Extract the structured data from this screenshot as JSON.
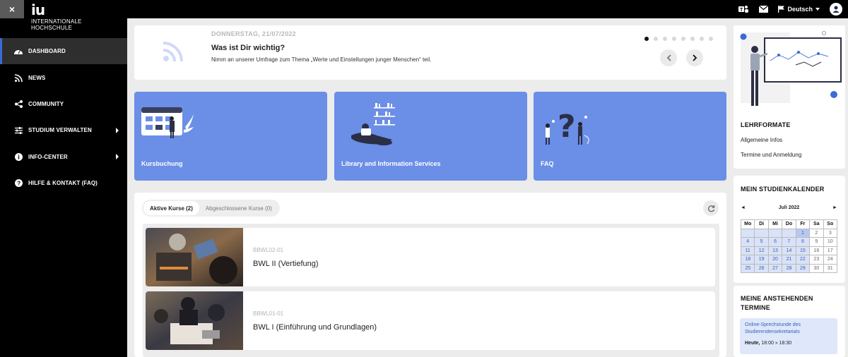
{
  "topbar": {
    "close_label": "×",
    "logo_mark": "iu",
    "logo_line1": "INTERNATIONALE",
    "logo_line2": "HOCHSCHULE",
    "teams_icon": "teams-icon",
    "mail_icon": "mail-icon",
    "language": "Deutsch",
    "profile_icon": "user-icon"
  },
  "sidebar": {
    "items": [
      {
        "label": "DASHBOARD",
        "icon": "dashboard-icon",
        "active": true
      },
      {
        "label": "NEWS",
        "icon": "rss-icon"
      },
      {
        "label": "COMMUNITY",
        "icon": "share-icon"
      },
      {
        "label": "STUDIUM VERWALTEN",
        "icon": "sliders-icon",
        "submenu": true
      },
      {
        "label": "INFO-CENTER",
        "icon": "info-icon",
        "submenu": true
      },
      {
        "label": "HILFE & KONTAKT (FAQ)",
        "icon": "help-icon"
      }
    ]
  },
  "announcement": {
    "date": "DONNERSTAG, 21/07/2022",
    "title": "Was ist Dir wichtig?",
    "text": "Nimm an unserer Umfrage zum Thema „Werte und Einstellungen junger Menschen“ teil.",
    "slide_count": 8,
    "active_slide": 1
  },
  "tiles": [
    {
      "label": "Kursbuchung"
    },
    {
      "label": "Library and Information Services"
    },
    {
      "label": "FAQ"
    }
  ],
  "courses": {
    "tabs": [
      "Aktive Kurse (2)",
      "Abgeschlossene Kurse (0)"
    ],
    "items": [
      {
        "code": "BBWL02-01",
        "name": "BWL II (Vertiefung)"
      },
      {
        "code": "BBWL01-01",
        "name": "BWL I (Einführung und Grundlagen)"
      }
    ]
  },
  "lehrformate": {
    "title": "LEHRFORMATE",
    "links": [
      "Allgemeine Infos",
      "Termine und Anmeldung"
    ]
  },
  "calendar": {
    "title": "MEIN STUDIENKALENDER",
    "prev": "◄",
    "next": "►",
    "month": "Juli 2022",
    "weekdays": [
      "Mo",
      "Di",
      "Mi",
      "Do",
      "Fr",
      "Sa",
      "So"
    ],
    "weeks": [
      [
        "",
        "",
        "",
        "",
        "1",
        "2",
        "3"
      ],
      [
        "4",
        "5",
        "6",
        "7",
        "8",
        "9",
        "10"
      ],
      [
        "11",
        "12",
        "13",
        "14",
        "15",
        "16",
        "17"
      ],
      [
        "18",
        "19",
        "20",
        "21",
        "22",
        "23",
        "24"
      ],
      [
        "25",
        "26",
        "27",
        "28",
        "29",
        "30",
        "31"
      ]
    ]
  },
  "termine": {
    "title_line1": "MEINE ANSTEHENDEN",
    "title_line2": "TERMINE",
    "item_title": "Online-Sprechstunde des Studierendensekretariats",
    "item_day": "Heute,",
    "item_time": "18:00 » 18:30"
  },
  "colors": {
    "accent": "#6b8ee6",
    "link_blue": "#3a5fb5"
  }
}
